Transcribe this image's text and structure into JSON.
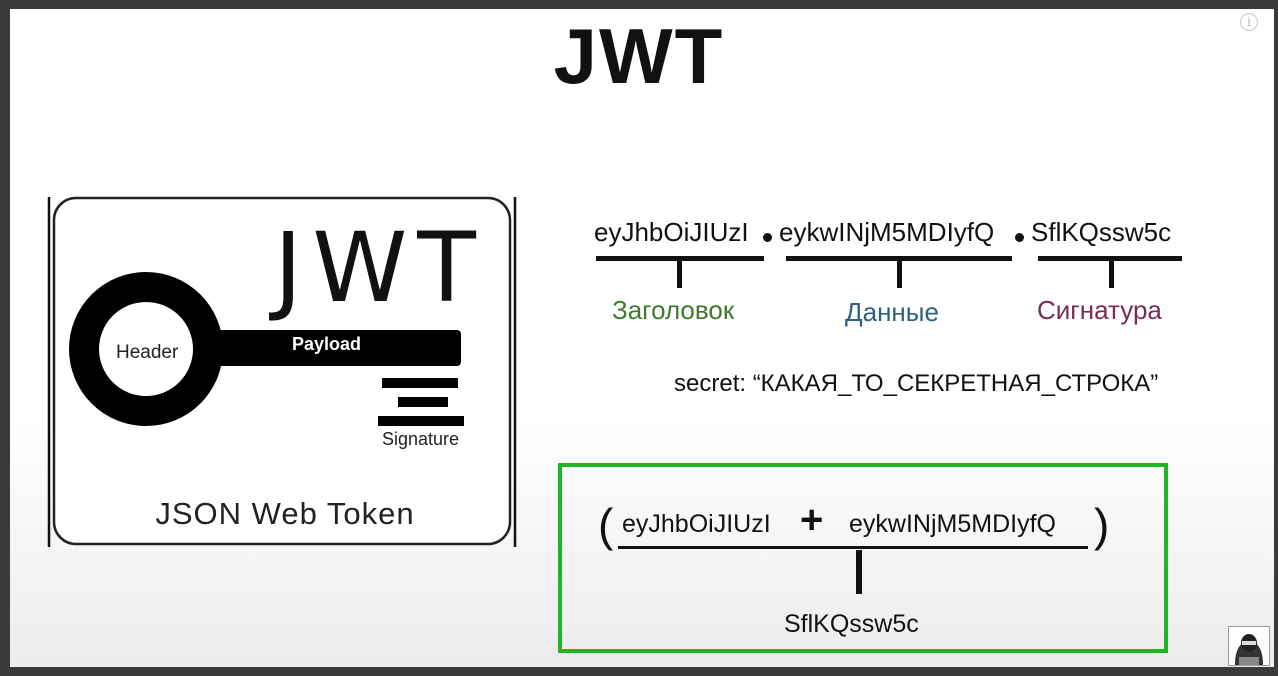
{
  "slide": {
    "title": "JWT",
    "info_icon": "info-icon"
  },
  "logo": {
    "jwt_text": "JWT",
    "header_label": "Header",
    "payload_label": "Payload",
    "signature_label": "Signature",
    "caption": "JSON Web Token"
  },
  "token": {
    "part1": "eyJhbOiJIUzI",
    "part2": "eykwINjM5MDIyfQ",
    "part3": "SflKQssw5c",
    "label1": "Заголовок",
    "label2": "Данные",
    "label3": "Сигнатура",
    "colors": {
      "label1": "#3f7a2e",
      "label2": "#2f5f82",
      "label3": "#7a2a5c"
    }
  },
  "secret_text": "secret: “КАКАЯ_ТО_СЕКРЕТНАЯ_СТРОКА”",
  "formula": {
    "open_paren": "(",
    "close_paren": ")",
    "operand1": "eyJhbOiJIUzI",
    "operator": "+",
    "operand2": "eykwINjM5MDIyfQ",
    "result": "SflKQssw5c",
    "border_color": "#22b522"
  },
  "avatar_icon": "hacker-avatar-icon"
}
